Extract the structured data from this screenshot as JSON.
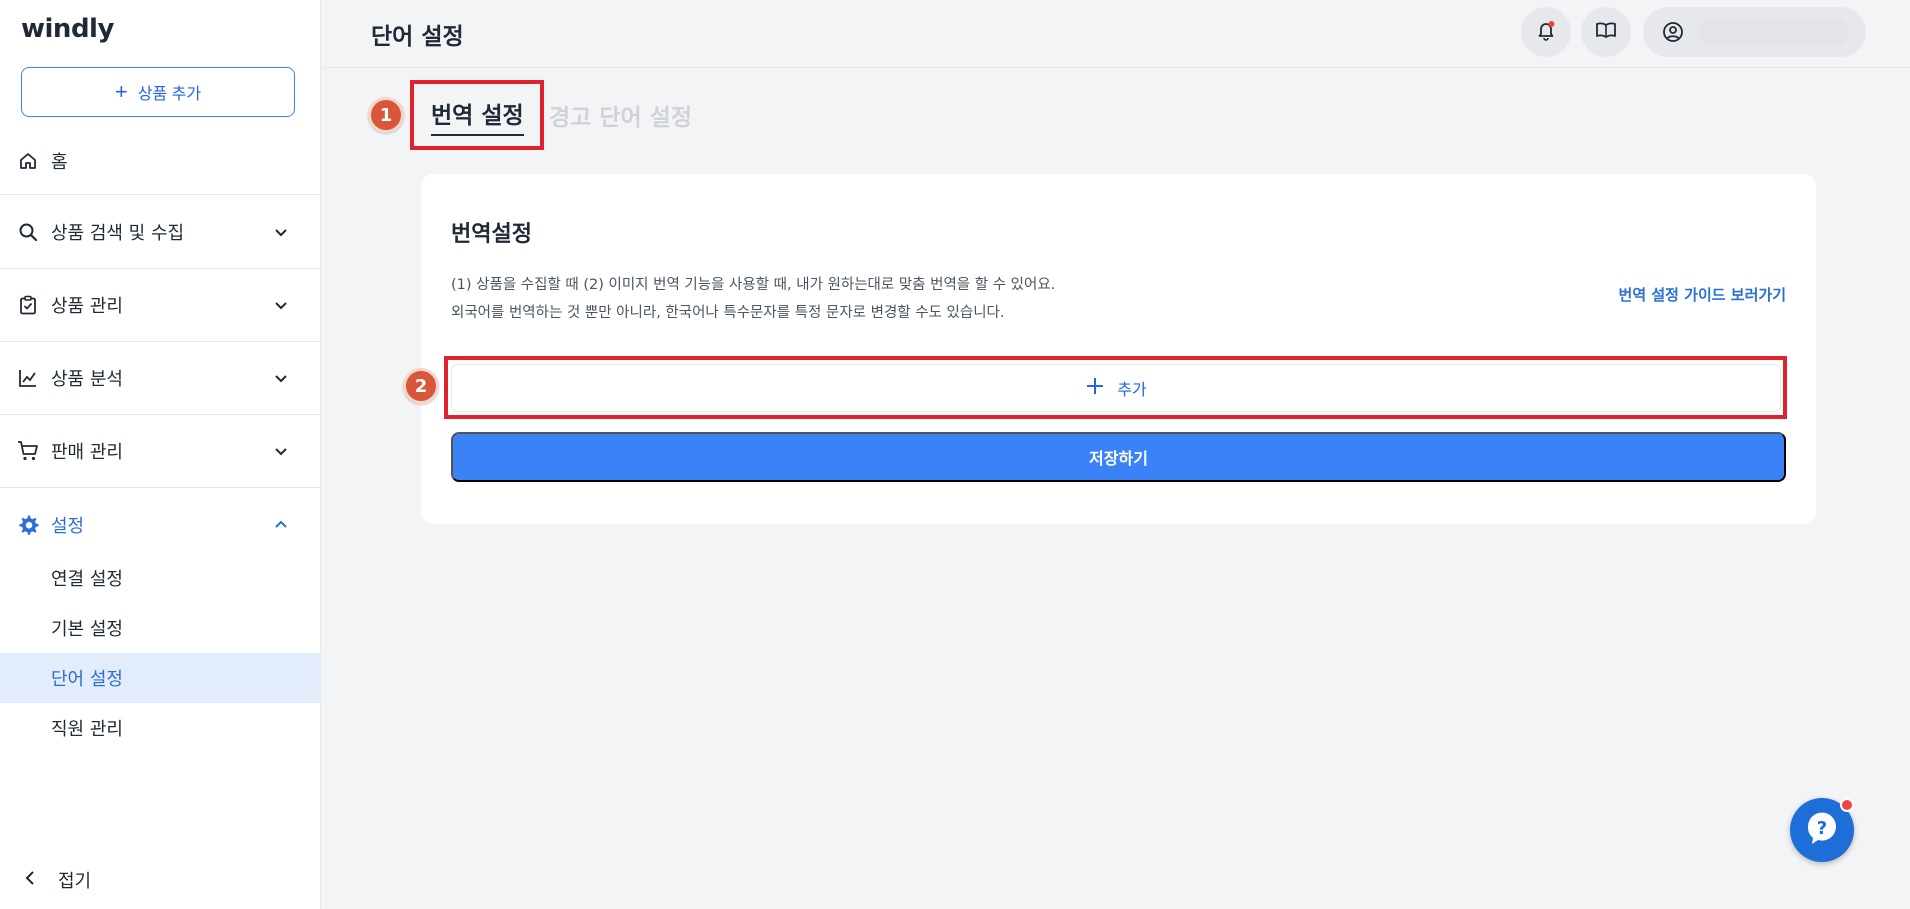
{
  "app": {
    "logo": "windly"
  },
  "sidebar": {
    "add_product_label": "상품 추가",
    "home": "홈",
    "items": [
      {
        "label": "상품 검색 및 수집"
      },
      {
        "label": "상품 관리"
      },
      {
        "label": "상품 분석"
      },
      {
        "label": "판매 관리"
      },
      {
        "label": "설정"
      }
    ],
    "sub_items": [
      {
        "label": "연결 설정"
      },
      {
        "label": "기본 설정"
      },
      {
        "label": "단어 설정"
      },
      {
        "label": "직원 관리"
      }
    ],
    "collapse_label": "접기"
  },
  "header": {
    "title": "단어 설정"
  },
  "tabs": {
    "active": "번역 설정",
    "inactive": "경고 단어 설정"
  },
  "annotations": {
    "badge1": "1",
    "badge2": "2"
  },
  "card": {
    "title": "번역설정",
    "desc_line1": "(1) 상품을 수집할 때 (2) 이미지 번역 기능을 사용할 때, 내가 원하는대로 맞춤 번역을 할 수 있어요.",
    "desc_line2": "외국어를 번역하는 것 뿐만 아니라, 한국어나 특수문자를 특정 문자로 변경할 수도 있습니다.",
    "guide_link": "번역 설정 가이드 보러가기",
    "add_label": "추가",
    "save_label": "저장하기"
  },
  "colors": {
    "accent": "#3b82f6",
    "highlight": "#e0222f",
    "badge": "#d8563a"
  }
}
